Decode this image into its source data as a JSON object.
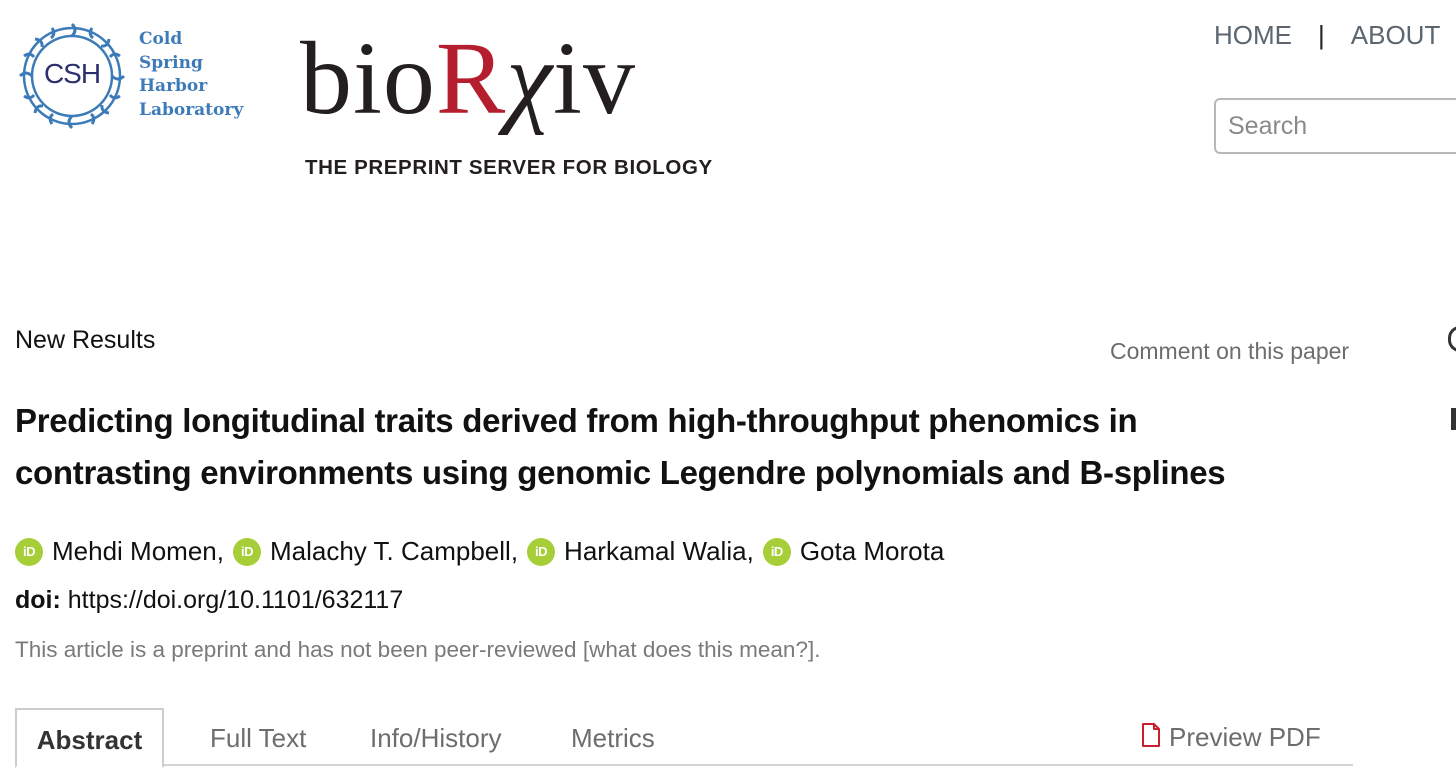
{
  "header": {
    "csh_logo": {
      "initials": "CSH",
      "name_lines": [
        "Cold",
        "Spring",
        "Harbor",
        "Laboratory"
      ]
    },
    "biorxiv_logo": {
      "word_prefix": "bio",
      "word_r": "R",
      "word_chi": "χ",
      "word_suffix": "iv",
      "tagline": "THE PREPRINT SERVER FOR BIOLOGY",
      "accent_color": "#b51e2e"
    },
    "nav": {
      "home": "HOME",
      "separator": "|",
      "about": "ABOUT"
    },
    "search": {
      "placeholder": "Search"
    }
  },
  "article": {
    "section_label": "New Results",
    "comment_link": "Comment on this paper",
    "title": "Predicting longitudinal traits derived from high-throughput phenomics in contrasting environments using genomic Legendre polynomials and B-splines",
    "authors": [
      {
        "name": "Mehdi Momen",
        "sep": ","
      },
      {
        "name": "Malachy T. Campbell",
        "sep": ","
      },
      {
        "name": "Harkamal Walia",
        "sep": ","
      },
      {
        "name": "Gota Morota",
        "sep": ""
      }
    ],
    "orcid_icon": "orcid-icon",
    "orcid_label": "iD",
    "orcid_color": "#a6ce39",
    "doi_label": "doi:",
    "doi_url": "https://doi.org/10.1101/632117",
    "preprint_note": "This article is a preprint and has not been peer-reviewed",
    "preprint_link": "[what does this mean?]",
    "preprint_end": "."
  },
  "tabs": {
    "abstract": "Abstract",
    "full_text": "Full Text",
    "info_history": "Info/History",
    "metrics": "Metrics",
    "preview_pdf": "Preview PDF",
    "pdf_icon": "pdf-file-icon",
    "pdf_icon_color": "#c8202f"
  }
}
